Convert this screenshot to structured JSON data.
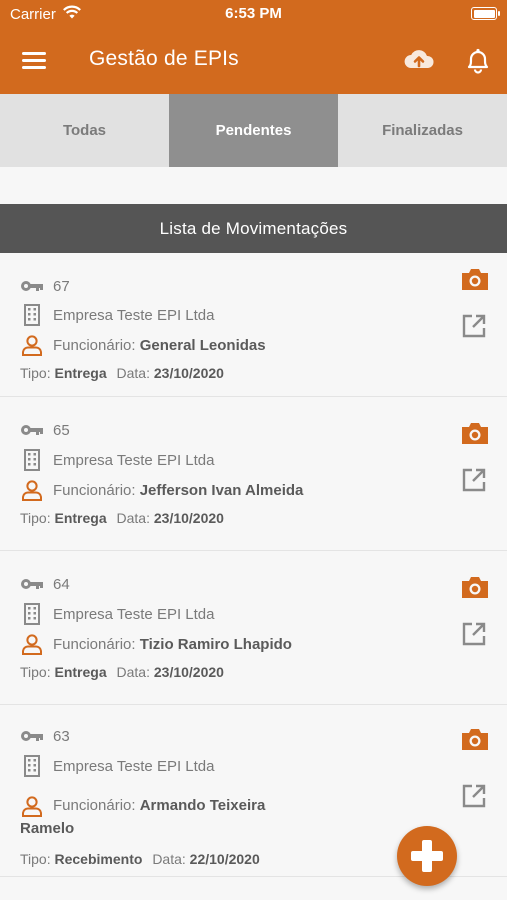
{
  "status_bar": {
    "carrier": "Carrier",
    "time": "6:53 PM"
  },
  "header": {
    "title": "Gestão de EPIs"
  },
  "tabs": [
    {
      "label": "Todas",
      "active": false
    },
    {
      "label": "Pendentes",
      "active": true
    },
    {
      "label": "Finalizadas",
      "active": false
    }
  ],
  "section": {
    "title": "Lista de Movimentações"
  },
  "labels": {
    "funcionario": "Funcionário:",
    "tipo": "Tipo:",
    "data": "Data:"
  },
  "items": [
    {
      "id": "67",
      "empresa": "Empresa Teste  EPI Ltda",
      "funcionario": "General Leonidas",
      "tipo": "Entrega",
      "data": "23/10/2020"
    },
    {
      "id": "65",
      "empresa": "Empresa Teste  EPI Ltda",
      "funcionario": "Jefferson Ivan Almeida",
      "tipo": "Entrega",
      "data": "23/10/2020"
    },
    {
      "id": "64",
      "empresa": "Empresa Teste  EPI Ltda",
      "funcionario": "Tizio Ramiro Lhapido",
      "tipo": "Entrega",
      "data": "23/10/2020"
    },
    {
      "id": "63",
      "empresa": "Empresa Teste  EPI Ltda",
      "funcionario": "Armando Teixeira",
      "funcionario_line2": "Ramelo",
      "tipo": "Recebimento",
      "data": "22/10/2020"
    }
  ],
  "colors": {
    "accent": "#d26a1e",
    "section_bar": "#555555",
    "tab_active": "#8f8f8f",
    "tab_bg": "#e1e1e1"
  },
  "icons": [
    "menu-icon",
    "cloud-upload-icon",
    "bell-icon",
    "key-icon",
    "building-icon",
    "person-icon",
    "camera-icon",
    "external-link-icon",
    "plus-icon"
  ]
}
